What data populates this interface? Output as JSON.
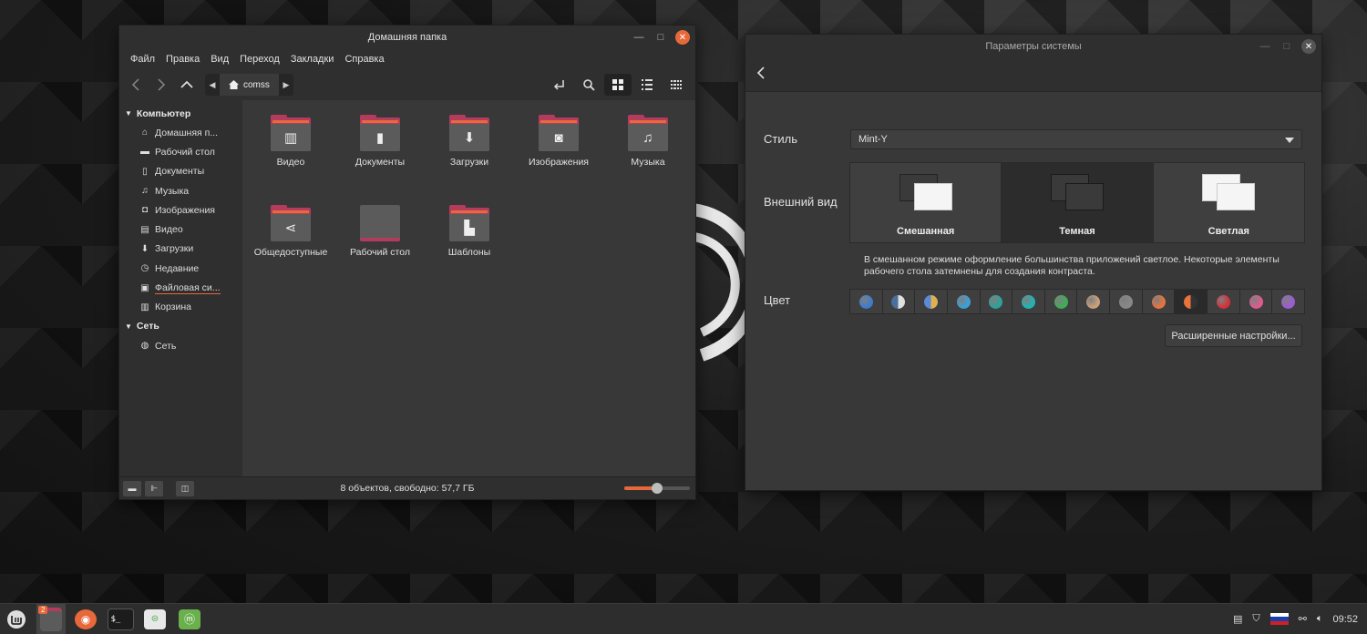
{
  "file_manager": {
    "title": "Домашняя папка",
    "menu": [
      "Файл",
      "Правка",
      "Вид",
      "Переход",
      "Закладки",
      "Справка"
    ],
    "path_crumb": "comss",
    "sidebar": {
      "computer_header": "Компьютер",
      "items": [
        {
          "label": "Домашняя п...",
          "icon": "home-icon"
        },
        {
          "label": "Рабочий стол",
          "icon": "desktop-icon"
        },
        {
          "label": "Документы",
          "icon": "document-icon"
        },
        {
          "label": "Музыка",
          "icon": "music-icon"
        },
        {
          "label": "Изображения",
          "icon": "camera-icon"
        },
        {
          "label": "Видео",
          "icon": "film-icon"
        },
        {
          "label": "Загрузки",
          "icon": "download-icon"
        },
        {
          "label": "Недавние",
          "icon": "clock-icon"
        },
        {
          "label": "Файловая си...",
          "icon": "drive-icon"
        },
        {
          "label": "Корзина",
          "icon": "trash-icon"
        }
      ],
      "network_header": "Сеть",
      "network_items": [
        {
          "label": "Сеть",
          "icon": "globe-icon"
        }
      ]
    },
    "items": [
      {
        "label": "Видео",
        "icon": "film-icon"
      },
      {
        "label": "Документы",
        "icon": "document-icon"
      },
      {
        "label": "Загрузки",
        "icon": "download-icon"
      },
      {
        "label": "Изображения",
        "icon": "camera-icon"
      },
      {
        "label": "Музыка",
        "icon": "music-icon"
      },
      {
        "label": "Общедоступные",
        "icon": "share-icon"
      },
      {
        "label": "Рабочий стол",
        "icon": "desktop-icon"
      },
      {
        "label": "Шаблоны",
        "icon": "template-icon"
      }
    ],
    "status": "8 объектов, свободно: 57,7 ГБ",
    "zoom_fraction": 0.5
  },
  "settings": {
    "title": "Параметры системы",
    "style_label": "Стиль",
    "style_value": "Mint-Y",
    "appearance_label": "Внешний вид",
    "appearance_options": [
      {
        "name": "Смешанная",
        "selected": false
      },
      {
        "name": "Темная",
        "selected": true
      },
      {
        "name": "Светлая",
        "selected": false
      }
    ],
    "description": "В смешанном режиме оформление большинства приложений светлое. Некоторые элементы рабочего стола затемнены для создания контраста.",
    "color_label": "Цвет",
    "colors": [
      "#3d7ccf",
      "#4a6f9a|#e0e0e0",
      "#5b8ad6|#e0b050",
      "#3aa0d8",
      "#2aa39a",
      "#1fb5b5",
      "#3dae56",
      "#c9a17a",
      "#888888",
      "#e8733d",
      "#e8733d|#333333",
      "#d6303b",
      "#e05a8e",
      "#9c5bd6"
    ],
    "selected_color": 10,
    "advanced_button": "Расширенные настройки..."
  },
  "taskbar": {
    "badge_count": "2",
    "clock": "09:52"
  }
}
